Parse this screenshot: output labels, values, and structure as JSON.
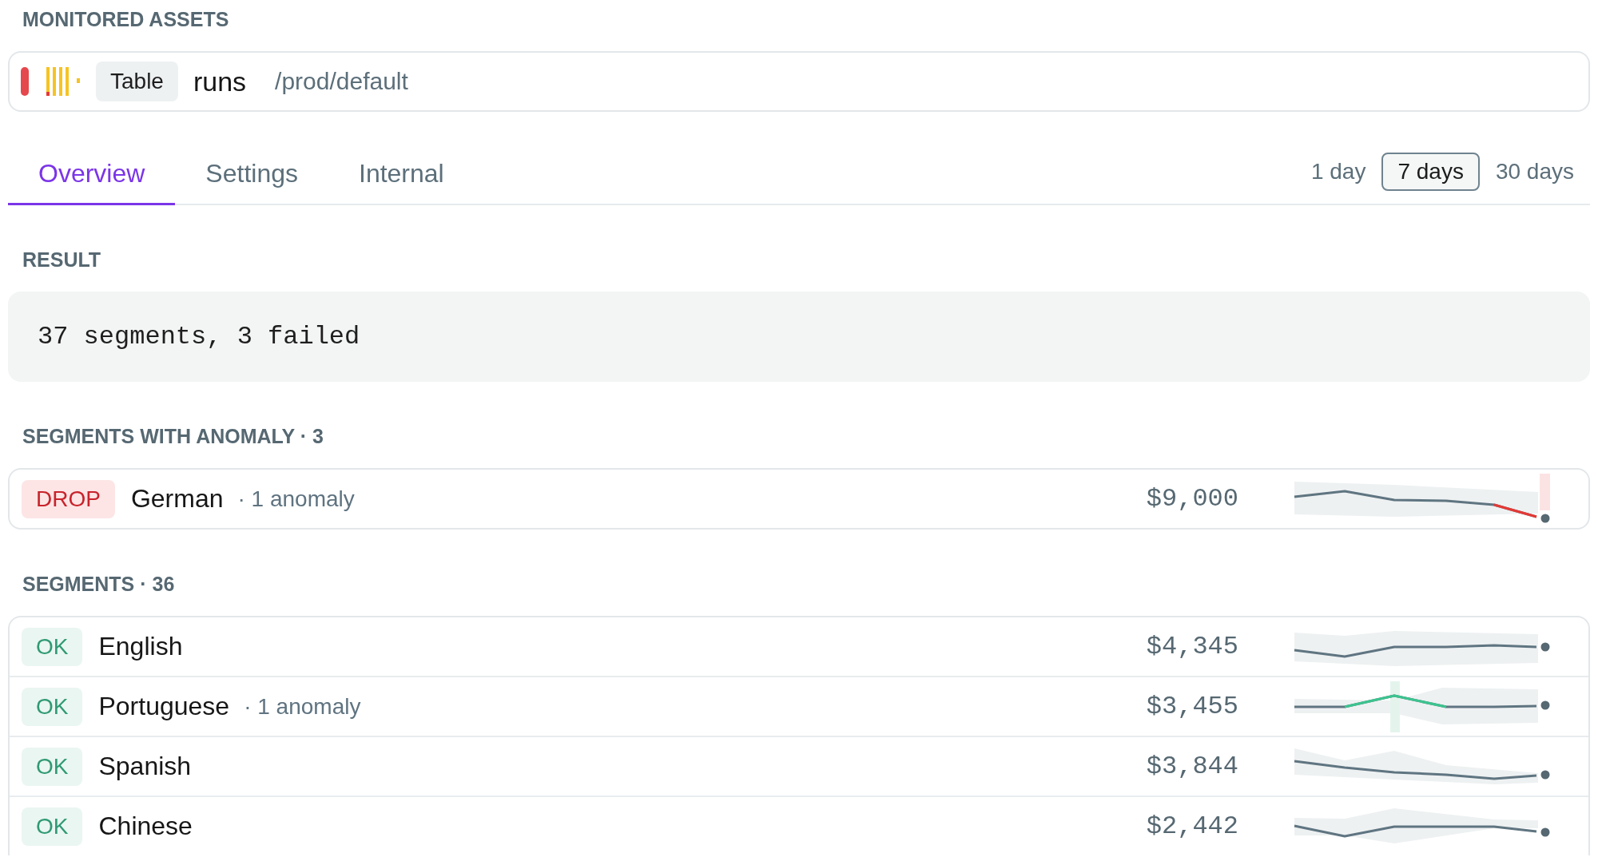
{
  "section_title": "MONITORED ASSETS",
  "assets": [
    {
      "color": "#e5484d",
      "type": "Table",
      "name": "runs",
      "path": "/prod/default"
    }
  ],
  "tabs": [
    {
      "label": "Overview",
      "selected": true
    },
    {
      "label": "Settings",
      "selected": false
    },
    {
      "label": "Internal",
      "selected": false
    }
  ],
  "time_ranges": [
    {
      "label": "1 day",
      "selected": false
    },
    {
      "label": "7 days",
      "selected": true
    },
    {
      "label": "30 days",
      "selected": false
    }
  ],
  "result": {
    "title": "RESULT",
    "text": "37 segments, 3 failed"
  },
  "anomalies": {
    "title": "SEGMENTS WITH ANOMALY · 3",
    "rows": [
      {
        "kind": "drop",
        "status": "DROP",
        "name": "German",
        "note": "· 1 anomaly",
        "value": "$9,000"
      }
    ]
  },
  "segments": {
    "title": "SEGMENTS · 36",
    "rows": [
      {
        "kind": "ok",
        "status": "OK",
        "name": "English",
        "value": "$4,345"
      },
      {
        "kind": "ok",
        "status": "OK",
        "name": "Portuguese",
        "note": "· 1 anomaly",
        "value": "$3,455"
      },
      {
        "kind": "ok",
        "status": "OK",
        "name": "Spanish",
        "value": "$3,844"
      },
      {
        "kind": "ok",
        "status": "OK",
        "name": "Chinese",
        "value": "$2,442"
      }
    ]
  }
}
